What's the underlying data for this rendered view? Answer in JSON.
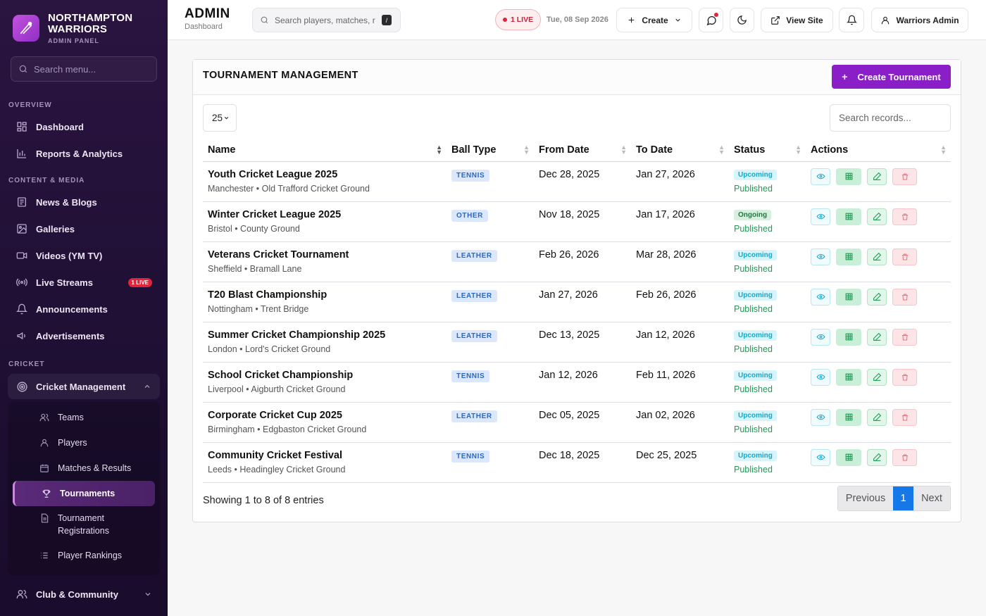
{
  "brand": {
    "name_line1": "NORTHAMPTON",
    "name_line2": "WARRIORS",
    "subtitle": "ADMIN PANEL"
  },
  "sidebar": {
    "search_placeholder": "Search menu...",
    "sections": {
      "overview": "OVERVIEW",
      "content_media": "CONTENT & MEDIA",
      "cricket": "CRICKET"
    },
    "items": {
      "dashboard": "Dashboard",
      "reports": "Reports & Analytics",
      "news": "News & Blogs",
      "galleries": "Galleries",
      "videos": "Videos (YM TV)",
      "live_streams": "Live Streams",
      "live_streams_badge": "1 LIVE",
      "announcements": "Announcements",
      "advertisements": "Advertisements",
      "cricket_management": "Cricket Management",
      "club_community": "Club & Community"
    },
    "cricket_sub": {
      "teams": "Teams",
      "players": "Players",
      "matches": "Matches & Results",
      "tournaments": "Tournaments",
      "registrations_line1": "Tournament",
      "registrations_line2": "Registrations",
      "rankings": "Player Rankings"
    }
  },
  "topbar": {
    "title": "ADMIN",
    "subtitle": "Dashboard",
    "search_placeholder": "Search players, matches, r",
    "search_shortcut": "/",
    "live_label": "1 LIVE",
    "date": "Tue, 08 Sep 2026",
    "create_label": "Create",
    "view_site_label": "View Site",
    "user_label": "Warriors Admin"
  },
  "card": {
    "title": "TOURNAMENT MANAGEMENT",
    "create_button": "Create Tournament",
    "page_length": "25",
    "search_placeholder": "Search records...",
    "columns": [
      "Name",
      "Ball Type",
      "From Date",
      "To Date",
      "Status",
      "Actions"
    ],
    "showing_text": "Showing 1 to 8 of 8 entries",
    "pagination": {
      "previous": "Previous",
      "current": "1",
      "next": "Next"
    }
  },
  "tournaments": [
    {
      "name": "Youth Cricket League 2025",
      "location": "Manchester • Old Trafford Cricket Ground",
      "ball": "TENNIS",
      "from": "Dec 28, 2025",
      "to": "Jan 27, 2026",
      "status": "Upcoming",
      "published": "Published"
    },
    {
      "name": "Winter Cricket League 2025",
      "location": "Bristol • County Ground",
      "ball": "OTHER",
      "from": "Nov 18, 2025",
      "to": "Jan 17, 2026",
      "status": "Ongoing",
      "published": "Published"
    },
    {
      "name": "Veterans Cricket Tournament",
      "location": "Sheffield • Bramall Lane",
      "ball": "LEATHER",
      "from": "Feb 26, 2026",
      "to": "Mar 28, 2026",
      "status": "Upcoming",
      "published": "Published"
    },
    {
      "name": "T20 Blast Championship",
      "location": "Nottingham • Trent Bridge",
      "ball": "LEATHER",
      "from": "Jan 27, 2026",
      "to": "Feb 26, 2026",
      "status": "Upcoming",
      "published": "Published"
    },
    {
      "name": "Summer Cricket Championship 2025",
      "location": "London • Lord's Cricket Ground",
      "ball": "LEATHER",
      "from": "Dec 13, 2025",
      "to": "Jan 12, 2026",
      "status": "Upcoming",
      "published": "Published"
    },
    {
      "name": "School Cricket Championship",
      "location": "Liverpool • Aigburth Cricket Ground",
      "ball": "TENNIS",
      "from": "Jan 12, 2026",
      "to": "Feb 11, 2026",
      "status": "Upcoming",
      "published": "Published"
    },
    {
      "name": "Corporate Cricket Cup 2025",
      "location": "Birmingham • Edgbaston Cricket Ground",
      "ball": "LEATHER",
      "from": "Dec 05, 2025",
      "to": "Jan 02, 2026",
      "status": "Upcoming",
      "published": "Published"
    },
    {
      "name": "Community Cricket Festival",
      "location": "Leeds • Headingley Cricket Ground",
      "ball": "TENNIS",
      "from": "Dec 18, 2025",
      "to": "Dec 25, 2025",
      "status": "Upcoming",
      "published": "Published"
    }
  ],
  "icons": [
    "search-icon",
    "dashboard-icon",
    "chart-icon",
    "news-icon",
    "gallery-icon",
    "video-icon",
    "broadcast-icon",
    "bell-icon",
    "megaphone-icon",
    "target-icon",
    "users-icon",
    "user-icon",
    "calendar-icon",
    "trophy-icon",
    "document-icon",
    "list-icon",
    "plus-icon",
    "chevron-down-icon",
    "chat-icon",
    "moon-icon",
    "external-link-icon",
    "eye-icon",
    "table-icon",
    "edit-icon",
    "trash-icon"
  ],
  "colors": {
    "accent": "#8a1fc7",
    "sidebar_bg": "#2a1440",
    "live": "#e0243a",
    "pager_active": "#1677e8"
  }
}
